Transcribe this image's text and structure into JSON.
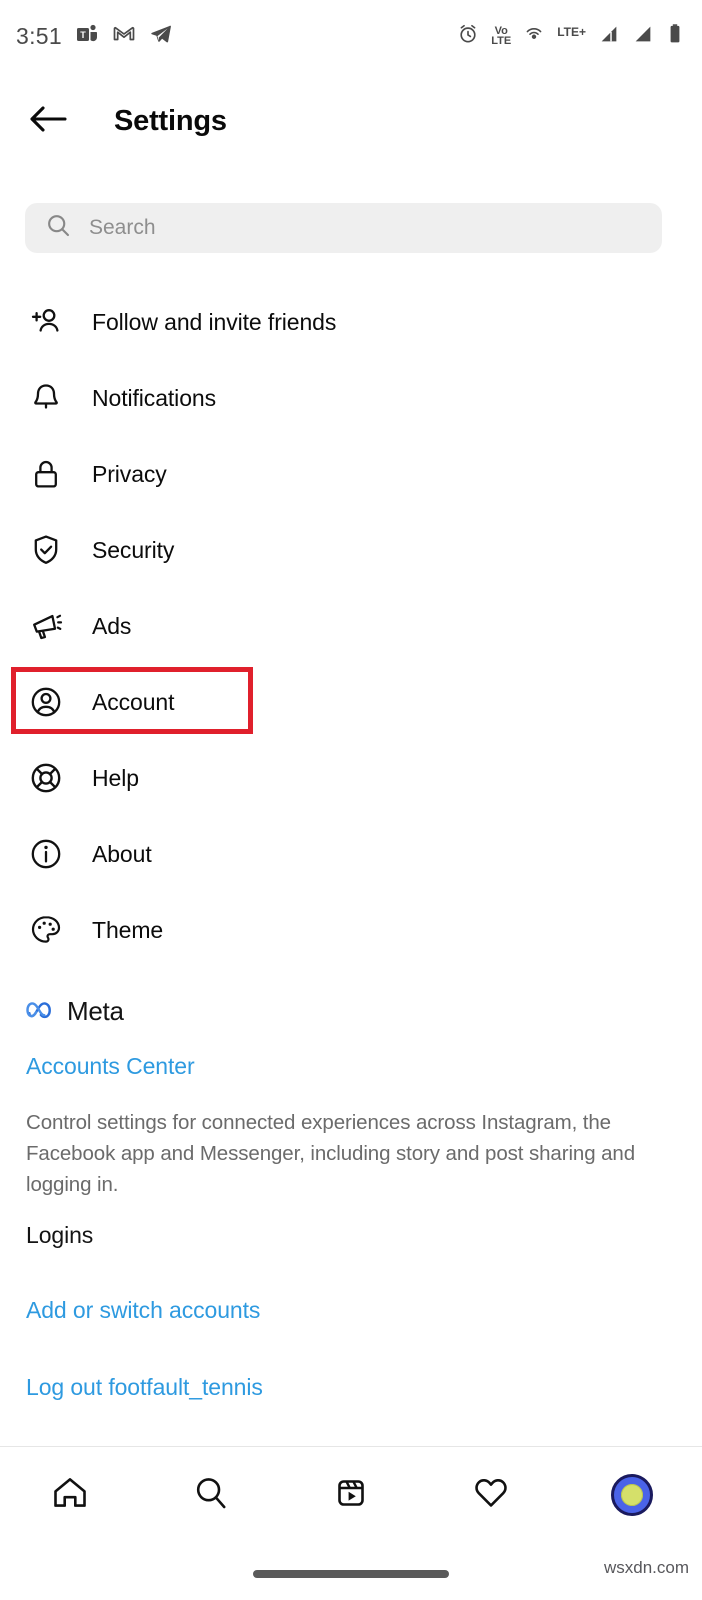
{
  "statusbar": {
    "time": "3:51",
    "left_icons": [
      "teams-icon",
      "gmail-icon",
      "telegram-icon"
    ],
    "right_icons": [
      "alarm-icon",
      "volte-icon",
      "hotspot-icon",
      "lte-plus-icon",
      "signal-1-icon",
      "signal-2-icon",
      "battery-icon"
    ],
    "volte_top": "Vo",
    "volte_bottom": "LTE",
    "network_label": "LTE+"
  },
  "header": {
    "back_icon": "back-arrow-icon",
    "title": "Settings"
  },
  "search": {
    "icon": "search-icon",
    "placeholder": "Search",
    "value": ""
  },
  "menu": {
    "items": [
      {
        "label": "Follow and invite friends",
        "icon": "person-add-icon",
        "highlighted": false
      },
      {
        "label": "Notifications",
        "icon": "bell-icon",
        "highlighted": false
      },
      {
        "label": "Privacy",
        "icon": "lock-icon",
        "highlighted": false
      },
      {
        "label": "Security",
        "icon": "shield-check-icon",
        "highlighted": false
      },
      {
        "label": "Ads",
        "icon": "megaphone-icon",
        "highlighted": false
      },
      {
        "label": "Account",
        "icon": "account-circle-icon",
        "highlighted": true
      },
      {
        "label": "Help",
        "icon": "life-ring-icon",
        "highlighted": false
      },
      {
        "label": "About",
        "icon": "info-circle-icon",
        "highlighted": false
      },
      {
        "label": "Theme",
        "icon": "palette-icon",
        "highlighted": false
      }
    ]
  },
  "meta": {
    "logo_icon": "meta-infinity-icon",
    "brand": "Meta",
    "accounts_center_label": "Accounts Center",
    "description": "Control settings for connected experiences across Instagram, the Facebook app and Messenger, including story and post sharing and logging in."
  },
  "logins": {
    "title": "Logins",
    "add_switch_label": "Add or switch accounts",
    "logout_label": "Log out footfault_tennis"
  },
  "bottom_nav": {
    "items": [
      {
        "icon": "home-icon",
        "label": "Home"
      },
      {
        "icon": "search-icon",
        "label": "Search"
      },
      {
        "icon": "reels-icon",
        "label": "Reels"
      },
      {
        "icon": "heart-icon",
        "label": "Activity"
      },
      {
        "icon": "profile-avatar-icon",
        "label": "Profile"
      }
    ]
  },
  "watermark": "wsxdn.com",
  "colors": {
    "link_blue": "#2e9ae0",
    "highlight_red": "#e0202c",
    "meta_blue": "#2b6ed9",
    "search_bg": "#efefef",
    "text_primary": "#0c0c0c",
    "text_muted": "#6b6b6b"
  }
}
